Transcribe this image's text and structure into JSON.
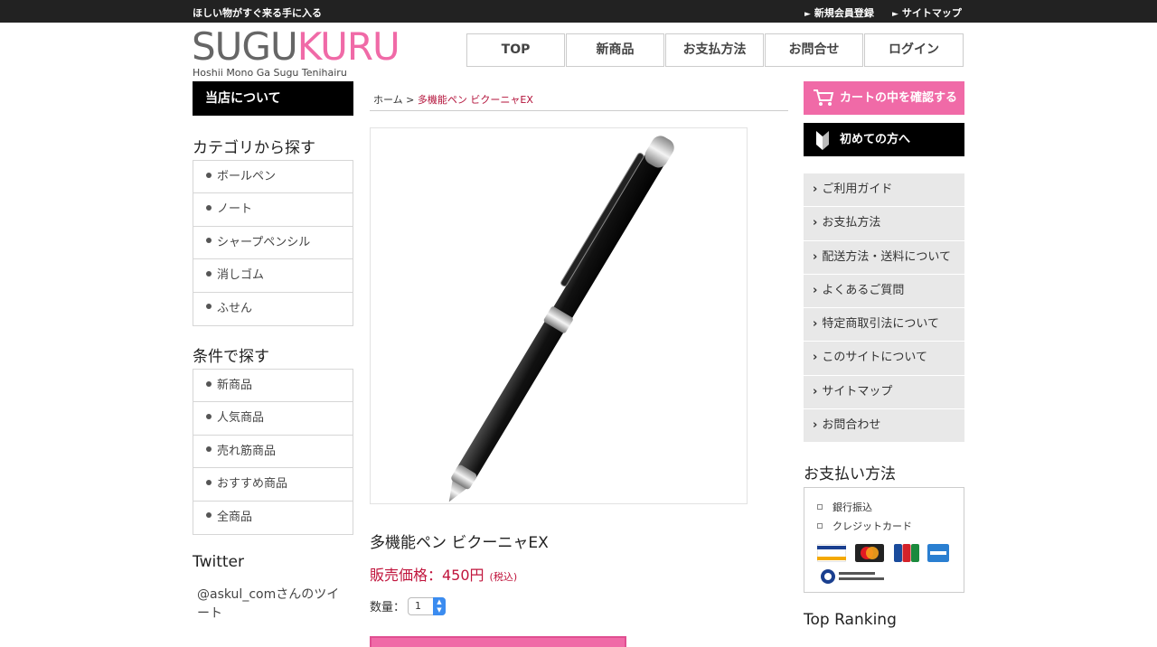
{
  "topbar": {
    "tagline": "ほしい物がすぐ来る手に入る",
    "links": [
      "新規会員登録",
      "サイトマップ"
    ]
  },
  "logo": {
    "part1": "SUGU",
    "part2": "KURU",
    "sub": "Hoshii Mono Ga Sugu Tenihairu"
  },
  "nav": [
    "TOP",
    "新商品",
    "お支払方法",
    "お問合せ",
    "ログイン"
  ],
  "left": {
    "about": "当店について",
    "category_title": "カテゴリから探す",
    "categories": [
      "ボールペン",
      "ノート",
      "シャープペンシル",
      "消しゴム",
      "ふせん"
    ],
    "condition_title": "条件で探す",
    "conditions": [
      "新商品",
      "人気商品",
      "売れ筋商品",
      "おすすめ商品",
      "全商品"
    ],
    "twitter_title": "Twitter",
    "twitter_text": "@askul_comさんのツイート"
  },
  "breadcrumb": {
    "home": "ホーム",
    "sep": ">",
    "current": "多機能ペン ビクーニャEX"
  },
  "product": {
    "name": "多機能ペン ビクーニャEX",
    "price": "販売価格：450円",
    "tax": "(税込)",
    "qty_label": "数量：",
    "qty_value": "1"
  },
  "right": {
    "cart_check": "カートの中を確認する",
    "first_time": "初めての方へ",
    "guide": [
      "ご利用ガイド",
      "お支払方法",
      "配送方法・送料について",
      "よくあるご質問",
      "特定商取引法について",
      "このサイトについて",
      "サイトマップ",
      "お問合わせ"
    ],
    "pay_title": "お支払い方法",
    "pay_methods": [
      "銀行振込",
      "クレジットカード"
    ],
    "cards": [
      "VISA",
      "MasterCard",
      "JCB",
      "AMEX",
      "Diners Club International"
    ],
    "ranking_title": "Top Ranking"
  },
  "colors": {
    "accent_pink": "#f06aa7",
    "price_red": "#c0143c",
    "dark": "#222222"
  }
}
